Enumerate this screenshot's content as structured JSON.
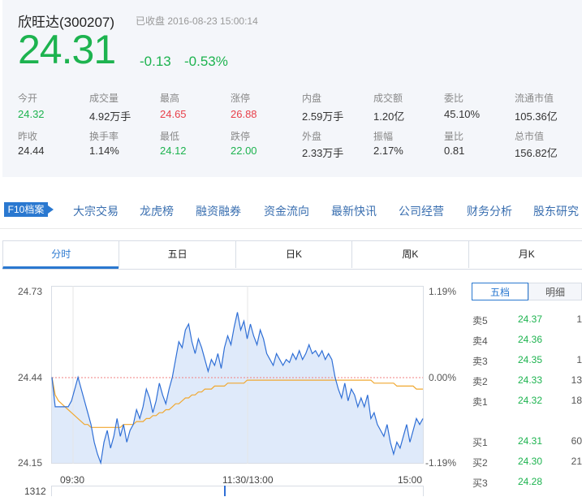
{
  "stock": {
    "name": "欣旺达",
    "code": "(300207)",
    "status": "已收盘 2016-08-23  15:00:14",
    "price": "24.31",
    "change": "-0.13",
    "change_pct": "-0.53%"
  },
  "stats": {
    "row1": [
      {
        "label": "今开",
        "value": "24.32",
        "color": "green"
      },
      {
        "label": "成交量",
        "value": "4.92万手",
        "color": "normal"
      },
      {
        "label": "最高",
        "value": "24.65",
        "color": "red"
      },
      {
        "label": "涨停",
        "value": "26.88",
        "color": "red"
      },
      {
        "label": "内盘",
        "value": "2.59万手",
        "color": "normal"
      },
      {
        "label": "成交额",
        "value": "1.20亿",
        "color": "normal"
      },
      {
        "label": "委比",
        "value": "45.10%",
        "color": "normal"
      },
      {
        "label": "流通市值",
        "value": "105.36亿",
        "color": "normal"
      }
    ],
    "row2": [
      {
        "label": "昨收",
        "value": "24.44",
        "color": "normal"
      },
      {
        "label": "换手率",
        "value": "1.14%",
        "color": "normal"
      },
      {
        "label": "最低",
        "value": "24.12",
        "color": "green"
      },
      {
        "label": "跌停",
        "value": "22.00",
        "color": "green"
      },
      {
        "label": "外盘",
        "value": "2.33万手",
        "color": "normal"
      },
      {
        "label": "振幅",
        "value": "2.17%",
        "color": "normal"
      },
      {
        "label": "量比",
        "value": "0.81",
        "color": "normal"
      },
      {
        "label": "总市值",
        "value": "156.82亿",
        "color": "normal"
      }
    ]
  },
  "nav": {
    "f10": "F10档案",
    "items": [
      "大宗交易",
      "龙虎榜",
      "融资融券",
      "资金流向",
      "最新快讯",
      "公司经营",
      "财务分析",
      "股东研究"
    ]
  },
  "tabs": [
    "分时",
    "五日",
    "日K",
    "周K",
    "月K"
  ],
  "chart": {
    "y_left": [
      "24.73",
      "24.44",
      "24.15"
    ],
    "y_right": [
      "1.19%",
      "0.00%",
      "-1.19%"
    ],
    "x_labels": [
      "09:30",
      "11:30/13:00",
      "15:00"
    ],
    "volume_label": "1312"
  },
  "chart_data": {
    "type": "line",
    "ylim": [
      24.15,
      24.73
    ],
    "prev_close": 24.44,
    "series": [],
    "price": [
      24.44,
      24.34,
      24.34,
      24.34,
      24.34,
      24.34,
      24.36,
      24.4,
      24.44,
      24.4,
      24.36,
      24.32,
      24.28,
      24.22,
      24.18,
      24.15,
      24.22,
      24.26,
      24.2,
      24.24,
      24.3,
      24.24,
      24.28,
      24.22,
      24.26,
      24.28,
      24.33,
      24.3,
      24.34,
      24.4,
      24.37,
      24.32,
      24.36,
      24.42,
      24.38,
      24.35,
      24.4,
      24.44,
      24.5,
      24.56,
      24.54,
      24.6,
      24.62,
      24.56,
      24.52,
      24.57,
      24.54,
      24.5,
      24.46,
      24.5,
      24.48,
      24.52,
      24.47,
      24.54,
      24.58,
      24.55,
      24.61,
      24.66,
      24.6,
      24.63,
      24.57,
      24.62,
      24.58,
      24.55,
      24.6,
      24.57,
      24.52,
      24.5,
      24.48,
      24.52,
      24.5,
      24.48,
      24.5,
      24.49,
      24.52,
      24.5,
      24.53,
      24.5,
      24.52,
      24.55,
      24.52,
      24.53,
      24.51,
      24.53,
      24.5,
      24.52,
      24.5,
      24.44,
      24.4,
      24.37,
      24.42,
      24.36,
      24.4,
      24.38,
      24.34,
      24.37,
      24.34,
      24.38,
      24.3,
      24.32,
      24.28,
      24.26,
      24.24,
      24.28,
      24.22,
      24.18,
      24.22,
      24.2,
      24.24,
      24.28,
      24.22,
      24.26,
      24.3,
      24.28,
      24.3
    ],
    "avg": [
      24.44,
      24.38,
      24.36,
      24.35,
      24.34,
      24.33,
      24.32,
      24.31,
      24.3,
      24.29,
      24.28,
      24.28,
      24.27,
      24.27,
      24.27,
      24.27,
      24.27,
      24.27,
      24.27,
      24.27,
      24.27,
      24.27,
      24.28,
      24.28,
      24.28,
      24.28,
      24.29,
      24.29,
      24.29,
      24.3,
      24.3,
      24.31,
      24.31,
      24.32,
      24.32,
      24.33,
      24.33,
      24.34,
      24.35,
      24.35,
      24.36,
      24.37,
      24.37,
      24.38,
      24.38,
      24.39,
      24.39,
      24.4,
      24.4,
      24.4,
      24.41,
      24.41,
      24.41,
      24.41,
      24.42,
      24.42,
      24.42,
      24.42,
      24.42,
      24.42,
      24.43,
      24.43,
      24.43,
      24.43,
      24.43,
      24.43,
      24.43,
      24.43,
      24.43,
      24.43,
      24.43,
      24.43,
      24.43,
      24.43,
      24.43,
      24.43,
      24.43,
      24.43,
      24.43,
      24.43,
      24.43,
      24.43,
      24.43,
      24.43,
      24.43,
      24.43,
      24.43,
      24.43,
      24.43,
      24.43,
      24.43,
      24.43,
      24.43,
      24.43,
      24.43,
      24.43,
      24.43,
      24.43,
      24.43,
      24.42,
      24.42,
      24.42,
      24.42,
      24.42,
      24.42,
      24.42,
      24.41,
      24.41,
      24.41,
      24.41,
      24.41,
      24.41,
      24.4,
      24.4,
      24.4
    ]
  },
  "panel": {
    "tabs": [
      "五档",
      "明细"
    ],
    "sell": [
      {
        "label": "卖5",
        "price": "24.37",
        "vol": "1"
      },
      {
        "label": "卖4",
        "price": "24.36",
        "vol": ""
      },
      {
        "label": "卖3",
        "price": "24.35",
        "vol": "1"
      },
      {
        "label": "卖2",
        "price": "24.33",
        "vol": "13"
      },
      {
        "label": "卖1",
        "price": "24.32",
        "vol": "18"
      }
    ],
    "buy": [
      {
        "label": "买1",
        "price": "24.31",
        "vol": "60"
      },
      {
        "label": "买2",
        "price": "24.30",
        "vol": "21"
      },
      {
        "label": "买3",
        "price": "24.28",
        "vol": ""
      }
    ]
  },
  "colors": {
    "down": "#1db34f",
    "up": "#e8404a",
    "accent": "#2a78d0",
    "price_line": "#2f6fd6",
    "avg_line": "#f0a830"
  }
}
